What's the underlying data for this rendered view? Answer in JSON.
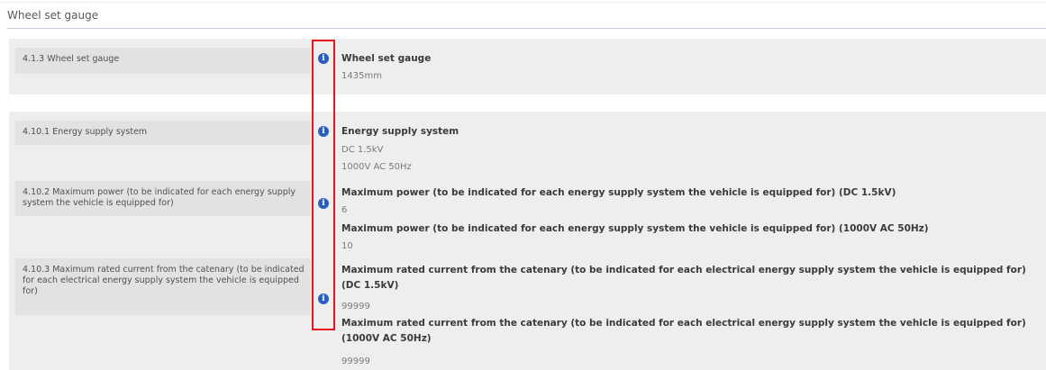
{
  "page": {
    "title": "Wheel set gauge"
  },
  "section_wheel": {
    "label": "4.1.3 Wheel set gauge",
    "value_title": "Wheel set gauge",
    "values": [
      "1435mm"
    ]
  },
  "section_energy": {
    "rows": [
      {
        "label": "4.10.1 Energy supply system",
        "blocks": [
          {
            "title": "Energy supply system",
            "values": [
              "DC 1.5kV",
              "1000V AC 50Hz"
            ]
          }
        ]
      },
      {
        "label": "4.10.2 Maximum power (to be indicated for each energy supply system the vehicle is equipped for)",
        "blocks": [
          {
            "title": "Maximum power (to be indicated for each energy supply system the vehicle is equipped for) (DC 1.5kV)",
            "values": [
              "6"
            ]
          },
          {
            "title": "Maximum power (to be indicated for each energy supply system the vehicle is equipped for) (1000V AC 50Hz)",
            "values": [
              "10"
            ]
          }
        ]
      },
      {
        "label": "4.10.3 Maximum rated current from the catenary (to be indicated for each electrical energy supply system the vehicle is equipped for)",
        "blocks": [
          {
            "title": "Maximum rated current from the catenary (to be indicated for each electrical energy supply system the vehicle is equipped for) (DC 1.5kV)",
            "values": [
              "99999"
            ]
          },
          {
            "title": "Maximum rated current from the catenary (to be indicated for each electrical energy supply system the vehicle is equipped for) (1000V AC 50Hz)",
            "values": [
              "99999"
            ]
          }
        ]
      }
    ]
  },
  "icons": {
    "info": "info-icon",
    "info_glyph": "i"
  },
  "colors": {
    "highlight": "#e8141b",
    "info_icon": "#2a5fbf",
    "row_band": "#eeeeee",
    "label_cell": "#e2e2e2"
  }
}
